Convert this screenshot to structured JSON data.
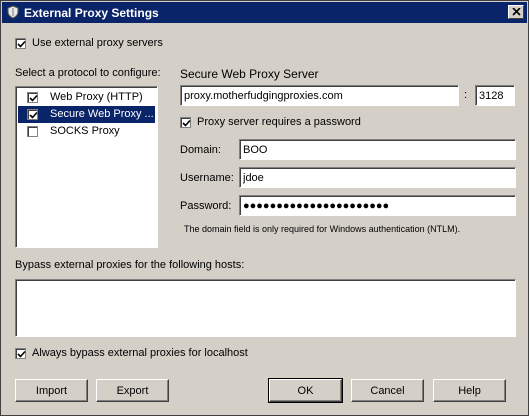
{
  "window": {
    "title": "External Proxy Settings"
  },
  "use_external": {
    "label": "Use external proxy servers",
    "checked": true
  },
  "protocol": {
    "heading": "Select a protocol to configure:",
    "items": [
      {
        "label": "Web Proxy (HTTP)",
        "checked": true,
        "selected": false
      },
      {
        "label": "Secure Web Proxy ...",
        "checked": true,
        "selected": true
      },
      {
        "label": "SOCKS Proxy",
        "checked": false,
        "selected": false
      }
    ]
  },
  "server": {
    "heading": "Secure Web Proxy Server",
    "host": "proxy.motherfudgingproxies.com",
    "colon": ":",
    "port": "3128"
  },
  "requires_password": {
    "label": "Proxy server requires a password",
    "checked": true
  },
  "fields": {
    "domain_label": "Domain:",
    "domain_value": "BOO",
    "username_label": "Username:",
    "username_value": "jdoe",
    "password_label": "Password:",
    "password_value": "●●●●●●●●●●●●●●●●●●●●●●"
  },
  "note": "The domain field is only required for Windows authentication (NTLM).",
  "bypass": {
    "label": "Bypass external proxies for the following hosts:",
    "value": ""
  },
  "localhost": {
    "label": "Always bypass external proxies for localhost",
    "checked": true
  },
  "buttons": {
    "import": "Import",
    "export": "Export",
    "ok": "OK",
    "cancel": "Cancel",
    "help": "Help"
  }
}
